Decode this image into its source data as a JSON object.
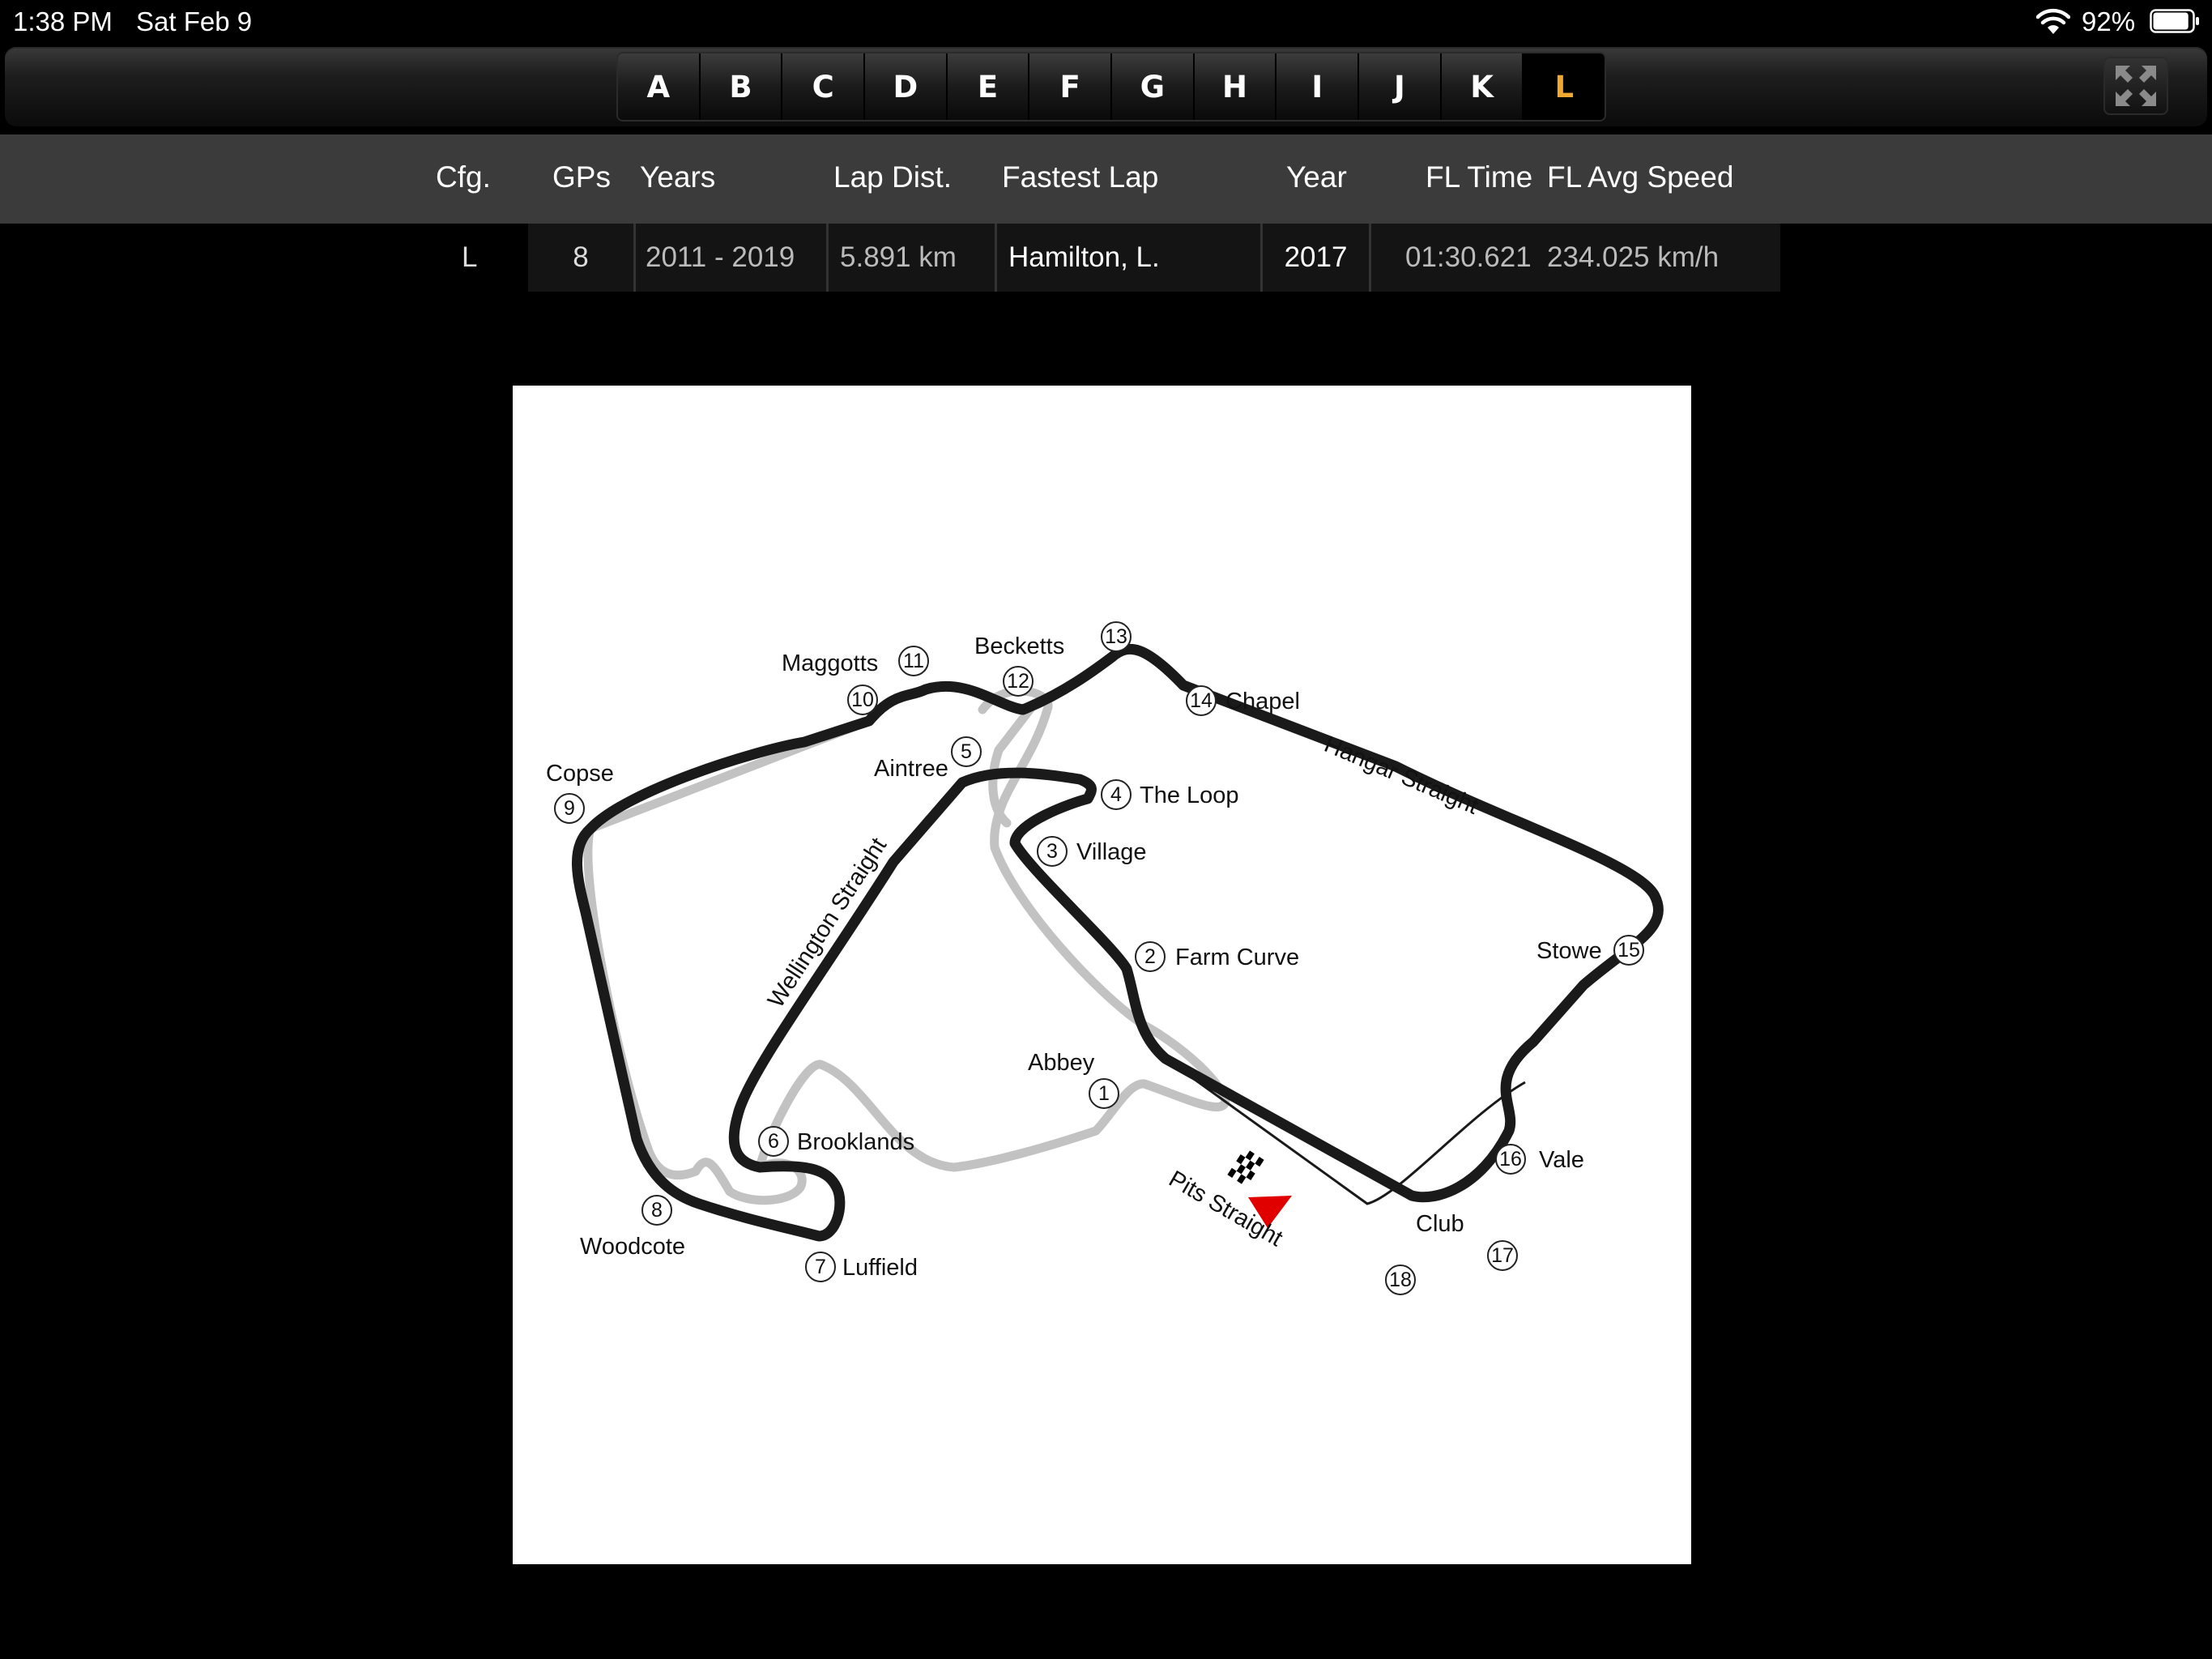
{
  "status_bar": {
    "time": "1:38 PM",
    "date": "Sat Feb 9",
    "battery_percent": "92%",
    "battery_level": 0.92
  },
  "toolbar": {
    "letters": [
      "A",
      "B",
      "C",
      "D",
      "E",
      "F",
      "G",
      "H",
      "I",
      "J",
      "K",
      "L"
    ],
    "selected_letter": "L",
    "expand_icon": "expand-arrows-icon"
  },
  "table": {
    "headers": {
      "cfg": "Cfg.",
      "gps": "GPs",
      "years": "Years",
      "lap_dist": "Lap Dist.",
      "fastest_lap": "Fastest Lap",
      "year": "Year",
      "fl_time": "FL Time",
      "fl_avg_speed": "FL Avg Speed"
    },
    "row": {
      "cfg": "L",
      "gps": "8",
      "years": "2011 - 2019",
      "lap_dist": "5.891 km",
      "fastest_lap": "Hamilton, L.",
      "year": "2017",
      "fl_time": "01:30.621",
      "fl_avg_speed": "234.025 km/h"
    }
  },
  "map": {
    "corners": [
      {
        "num": "1",
        "name": "Abbey"
      },
      {
        "num": "2",
        "name": "Farm Curve"
      },
      {
        "num": "3",
        "name": "Village"
      },
      {
        "num": "4",
        "name": "The Loop"
      },
      {
        "num": "5",
        "name": "Aintree"
      },
      {
        "num": "6",
        "name": "Brooklands"
      },
      {
        "num": "7",
        "name": "Luffield"
      },
      {
        "num": "8",
        "name": "Woodcote"
      },
      {
        "num": "9",
        "name": "Copse"
      },
      {
        "num": "10",
        "name": ""
      },
      {
        "num": "11",
        "name": "Maggotts"
      },
      {
        "num": "12",
        "name": ""
      },
      {
        "num": "13",
        "name": "Becketts"
      },
      {
        "num": "14",
        "name": "Chapel"
      },
      {
        "num": "15",
        "name": "Stowe"
      },
      {
        "num": "16",
        "name": "Vale"
      },
      {
        "num": "17",
        "name": ""
      },
      {
        "num": "18",
        "name": "Club"
      }
    ],
    "straights": {
      "hangar": "Hangar Straight",
      "wellington": "Wellington Straight",
      "pits": "Pits Straight"
    },
    "colors": {
      "track": "#1a1a1a",
      "old_track": "#c2c2c2",
      "direction_arrow": "#e00000"
    }
  }
}
